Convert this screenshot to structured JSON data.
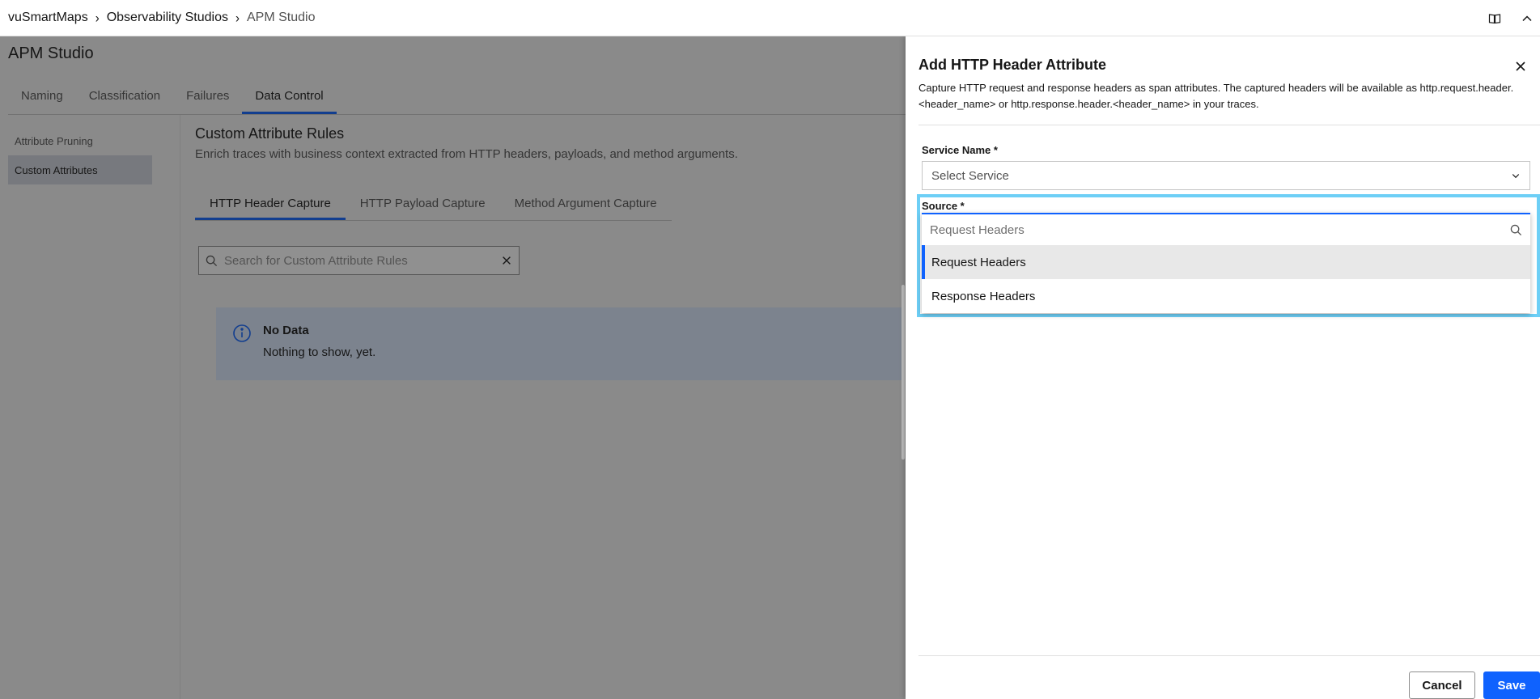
{
  "breadcrumb": {
    "items": [
      "vuSmartMaps",
      "Observability Studios",
      "APM Studio"
    ]
  },
  "page": {
    "title": "APM Studio",
    "tabs": [
      {
        "label": "Naming"
      },
      {
        "label": "Classification"
      },
      {
        "label": "Failures"
      },
      {
        "label": "Data Control"
      }
    ],
    "side_nav": [
      {
        "label": "Attribute Pruning"
      },
      {
        "label": "Custom Attributes"
      }
    ],
    "content": {
      "title": "Custom Attribute Rules",
      "subtitle": "Enrich traces with business context extracted from HTTP headers, payloads, and method arguments.",
      "sub_tabs": [
        {
          "label": "HTTP Header Capture"
        },
        {
          "label": "HTTP Payload Capture"
        },
        {
          "label": "Method Argument Capture"
        }
      ],
      "search_placeholder": "Search for Custom Attribute Rules",
      "no_data": {
        "title": "No Data",
        "message": "Nothing to show, yet."
      }
    }
  },
  "drawer": {
    "title": "Add HTTP Header Attribute",
    "description": "Capture HTTP request and response headers as span attributes. The captured headers will be available as http.request.header.<header_name> or http.response.header.<header_name> in your traces.",
    "service_name": {
      "label": "Service Name *",
      "placeholder": "Select Service"
    },
    "source": {
      "label": "Source *",
      "input_placeholder": "Request Headers",
      "options": [
        {
          "label": "Request Headers"
        },
        {
          "label": "Response Headers"
        }
      ]
    },
    "cancel_label": "Cancel",
    "save_label": "Save"
  },
  "colors": {
    "primary": "#0f62fe",
    "highlight": "#6dcff6",
    "info_bg": "#d8e6fb"
  }
}
